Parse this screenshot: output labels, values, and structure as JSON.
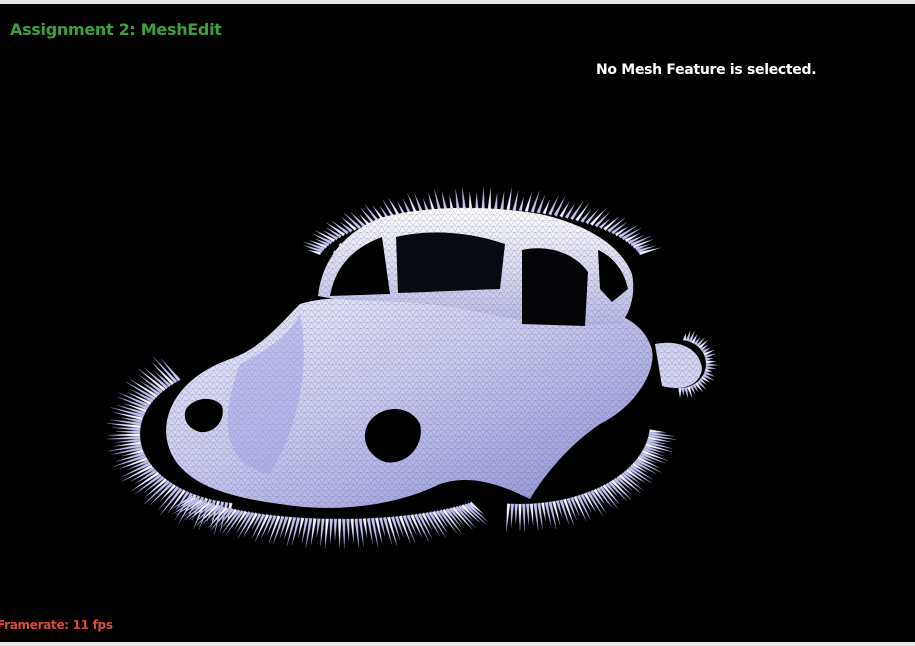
{
  "app": {
    "title": "Assignment 2: MeshEdit"
  },
  "hud": {
    "selection_status": "No Mesh Feature is selected.",
    "framerate_label": "Framerate:",
    "framerate_value": "11",
    "framerate_unit": "fps",
    "framerate_text": "Framerate: 11 fps"
  },
  "colors": {
    "background": "#000000",
    "title": "#3f9f3f",
    "status_text": "#ffffff",
    "framerate": "#e04a3a",
    "mesh_fill": "#c8c8f0",
    "mesh_shadow": "#8a8ad8",
    "mesh_lines": "#4a4a5a"
  },
  "scene": {
    "model": "beetle-car-mesh",
    "render_mode": "wireframe-shaded-with-normals"
  }
}
